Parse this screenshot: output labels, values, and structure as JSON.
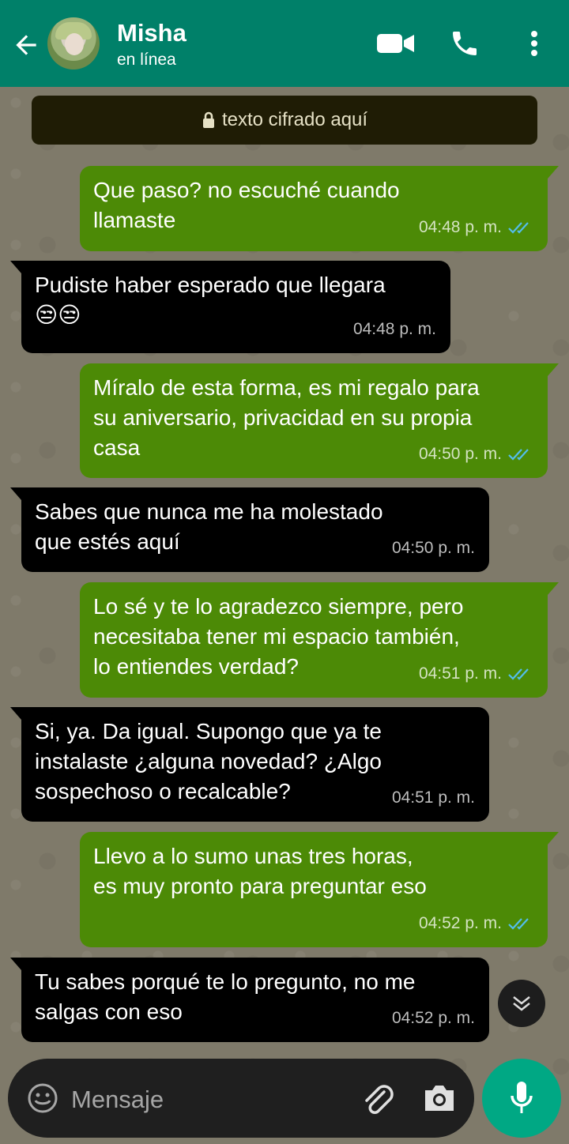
{
  "header": {
    "contact_name": "Misha",
    "status": "en línea"
  },
  "banner": {
    "text": "texto cifrado aquí",
    "icon": "lock-icon"
  },
  "messages": [
    {
      "direction": "out",
      "text": "Que paso? no escuché cuando\nllamaste",
      "time": "04:48 p. m.",
      "read": true
    },
    {
      "direction": "in",
      "text": "Pudiste haber esperado que llegara\n😒😒",
      "time": "04:48 p. m."
    },
    {
      "direction": "out",
      "text": "Míralo de esta forma, es mi regalo para\nsu aniversario, privacidad en su propia\ncasa",
      "time": "04:50 p. m.",
      "read": true
    },
    {
      "direction": "in",
      "text": "Sabes que nunca me ha molestado\nque estés aquí",
      "time": "04:50 p. m."
    },
    {
      "direction": "out",
      "text": "Lo sé y te lo agradezco siempre, pero\nnecesitaba tener mi espacio también,\nlo entiendes verdad?",
      "time": "04:51 p. m.",
      "read": true
    },
    {
      "direction": "in",
      "text": "Si, ya. Da igual. Supongo que ya te\ninstalaste ¿alguna novedad? ¿Algo\nsospechoso o recalcable?",
      "time": "04:51 p. m."
    },
    {
      "direction": "out",
      "text": "Llevo a lo sumo unas tres horas,\nes muy pronto para preguntar eso",
      "time": "04:52 p. m.",
      "read": true
    },
    {
      "direction": "in",
      "text": "Tu sabes porqué te lo pregunto, no me\nsalgas con eso",
      "time": "04:52 p. m."
    }
  ],
  "composer": {
    "placeholder": "Mensaje"
  },
  "colors": {
    "header": "#008069",
    "outgoing_bubble": "#4c8a06",
    "incoming_bubble": "#000000",
    "read_ticks": "#53bdeb",
    "mic_button": "#00a884"
  }
}
